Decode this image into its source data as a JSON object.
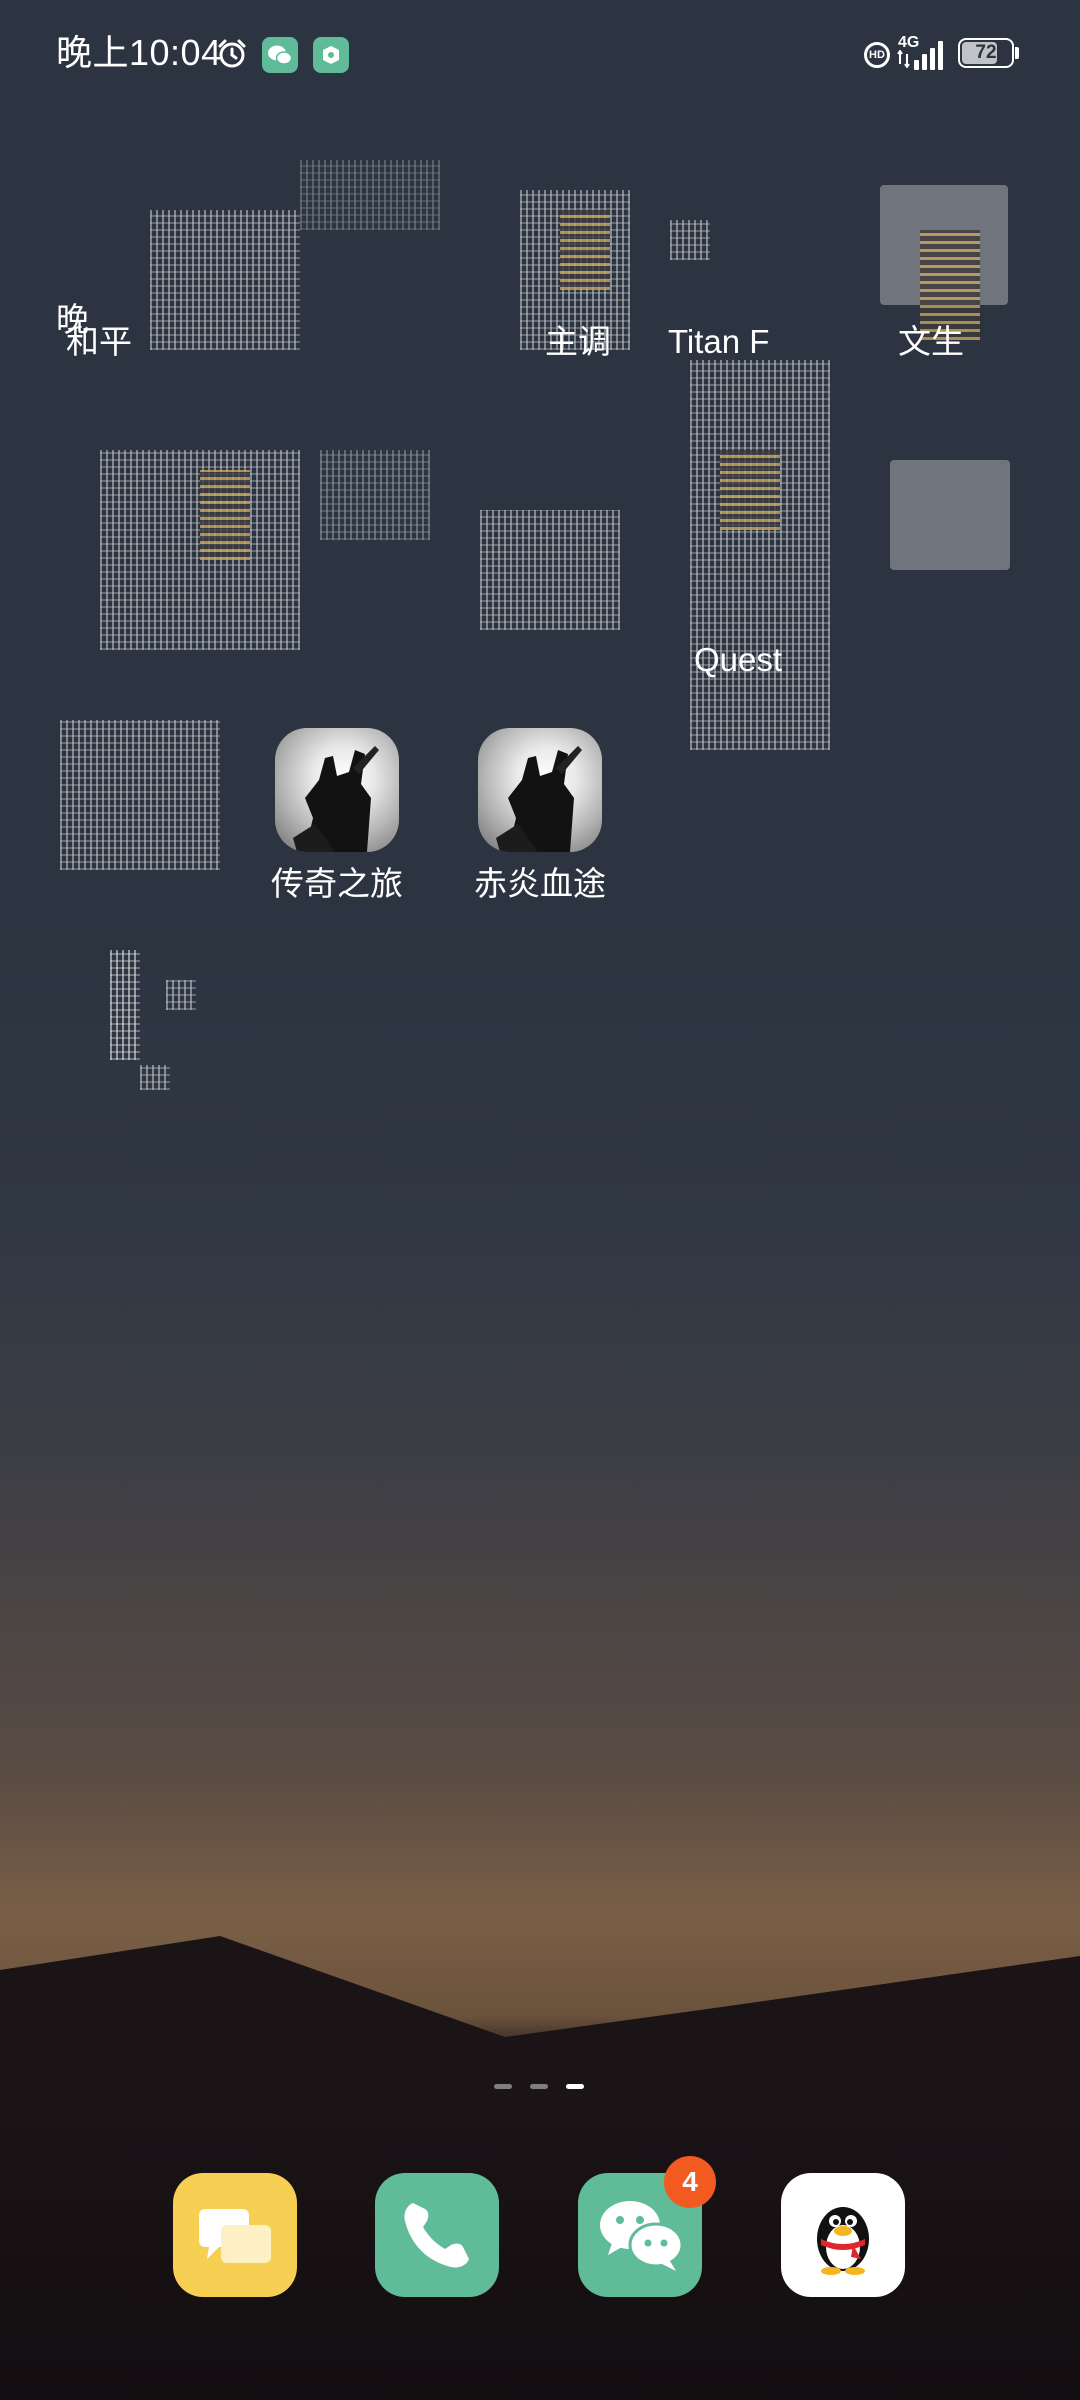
{
  "status_bar": {
    "time": "晚上10:04",
    "network_type": "4G",
    "hd_label": "HD",
    "battery_level": "72",
    "battery_percent": 72
  },
  "home_apps": {
    "partial_labels": {
      "top_left_fragment": "晚",
      "top_left_label": "和平",
      "top_mid_label": "主调",
      "top_right_center_label": "Titan F",
      "top_right_label": "文生",
      "middle_center_label": "Quest"
    },
    "apps": [
      {
        "label": "传奇之旅",
        "icon": "game-warrior-icon"
      },
      {
        "label": "赤炎血途",
        "icon": "game-warrior-icon"
      }
    ]
  },
  "page_indicator": {
    "count": 3,
    "active_index": 2
  },
  "dock": {
    "apps": [
      {
        "name": "messages",
        "icon": "message-bubbles-icon",
        "color": "#f6cf53"
      },
      {
        "name": "phone",
        "icon": "phone-handset-icon",
        "color": "#5fbb98"
      },
      {
        "name": "wechat",
        "icon": "wechat-icon",
        "color": "#5fbb98",
        "badge": "4"
      },
      {
        "name": "qq",
        "icon": "qq-penguin-icon",
        "color": "#ffffff"
      }
    ]
  },
  "colors": {
    "accent_green": "#5fbb98",
    "badge_orange": "#f25a1f",
    "wallpaper_top": "#2b3440"
  }
}
